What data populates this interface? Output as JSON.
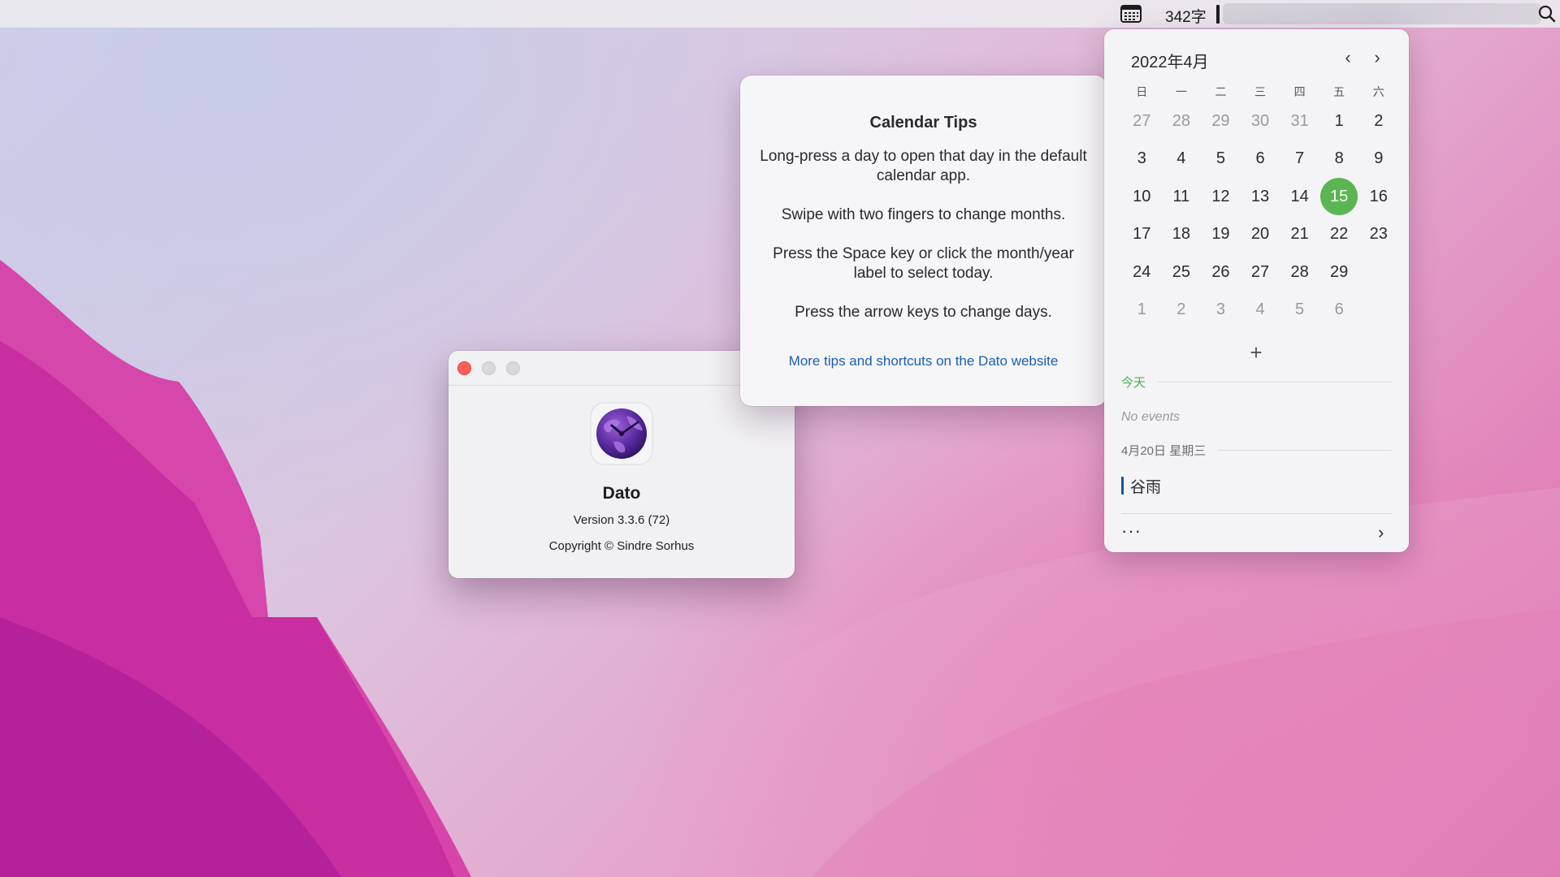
{
  "menubar": {
    "word_count": "342字"
  },
  "about": {
    "app_name": "Dato",
    "version": "Version 3.3.6 (72)",
    "copyright": "Copyright © Sindre Sorhus"
  },
  "tips": {
    "title": "Calendar Tips",
    "tip1": "Long-press a day to open that day in the default calendar app.",
    "tip2": "Swipe with two fingers to change months.",
    "tip3": "Press the Space key or click the month/year label to select today.",
    "tip4": "Press the arrow keys to change days.",
    "link": "More tips and shortcuts on the Dato website"
  },
  "calendar": {
    "month_label": "2022年4月",
    "prev": "‹",
    "next": "›",
    "weekdays": [
      "日",
      "一",
      "二",
      "三",
      "四",
      "五",
      "六"
    ],
    "weeks": [
      [
        {
          "d": "27",
          "dim": true
        },
        {
          "d": "28",
          "dim": true
        },
        {
          "d": "29",
          "dim": true
        },
        {
          "d": "30",
          "dim": true
        },
        {
          "d": "31",
          "dim": true
        },
        {
          "d": "1"
        },
        {
          "d": "2"
        }
      ],
      [
        {
          "d": "3"
        },
        {
          "d": "4"
        },
        {
          "d": "5"
        },
        {
          "d": "6"
        },
        {
          "d": "7"
        },
        {
          "d": "8"
        },
        {
          "d": "9"
        }
      ],
      [
        {
          "d": "10"
        },
        {
          "d": "11"
        },
        {
          "d": "12"
        },
        {
          "d": "13"
        },
        {
          "d": "14"
        },
        {
          "d": "15",
          "today": true
        },
        {
          "d": "16"
        }
      ],
      [
        {
          "d": "17"
        },
        {
          "d": "18"
        },
        {
          "d": "19"
        },
        {
          "d": "20"
        },
        {
          "d": "21"
        },
        {
          "d": "22"
        },
        {
          "d": "23"
        }
      ],
      [
        {
          "d": "24"
        },
        {
          "d": "25"
        },
        {
          "d": "26"
        },
        {
          "d": "27"
        },
        {
          "d": "28"
        },
        {
          "d": "29"
        },
        {
          "d": ""
        }
      ],
      [
        {
          "d": "1",
          "dim": true
        },
        {
          "d": "2",
          "dim": true
        },
        {
          "d": "3",
          "dim": true
        },
        {
          "d": "4",
          "dim": true
        },
        {
          "d": "5",
          "dim": true
        },
        {
          "d": "6",
          "dim": true
        },
        {
          "d": ""
        }
      ]
    ],
    "add": "+",
    "today_section": "今天",
    "no_events": "No events",
    "date_section": "4月20日 星期三",
    "event_title": "谷雨",
    "more": "···",
    "forward": "›"
  },
  "colors": {
    "today_highlight": "#5ab553",
    "link": "#1a5fb4",
    "event_bar": "#1f4f9a",
    "close_button": "#fe5f57"
  }
}
